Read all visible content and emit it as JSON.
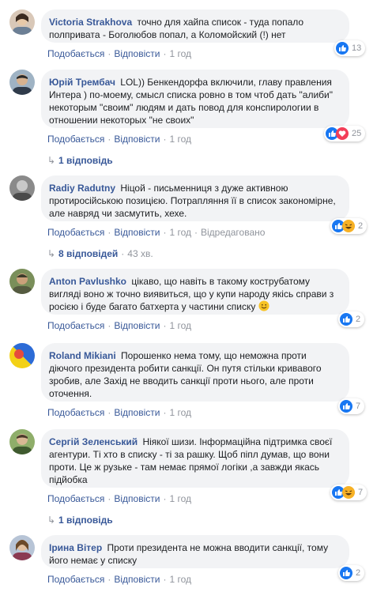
{
  "actions": {
    "like": "Подобається",
    "reply": "Відповісти"
  },
  "colors": {
    "link": "#385898",
    "bubble": "#f2f3f5",
    "like_blue": "#1877f2",
    "love_red": "#f33e58",
    "haha_yellow": "#f7b125"
  },
  "comments": [
    {
      "author": "Victoria Strakhova",
      "text": "точно для хайпа список - туда попало полприватa - Боголюбов попал, а Коломойский (!) нет",
      "time": "1 год",
      "reactions": {
        "icons": [
          "like-icon"
        ],
        "count": "13"
      }
    },
    {
      "author": "Юрій Трембач",
      "text": "LOL)) Бенкендорфа включили, главу правления Интера ) по-моему, смысл списка ровно в том чтоб дать \"алиби\" некоторым \"своим\" людям и дать повод для конспирологии в отношении некоторых \"не своих\"",
      "time": "1 год",
      "reactions": {
        "icons": [
          "like-icon",
          "love-icon"
        ],
        "count": "25"
      },
      "replies": "1 відповідь"
    },
    {
      "author": "Radiy Radutny",
      "text": "Ніцой - письменниця з дуже активною протиросійською позицією. Потрапляння її в список закономірне, але навряд чи засмутить, хехе.",
      "time": "1 год",
      "edited": "Відредаговано",
      "reactions": {
        "icons": [
          "like-icon",
          "haha-icon"
        ],
        "count": "2"
      },
      "replies": "8 відповідей",
      "replies_time": "43 хв."
    },
    {
      "author": "Anton Pavlushko",
      "text": "цікаво, що навіть в такому кострубатому вигляді воно ж точно виявиться, що у купи народу якісь справи з росією і буде багато батхерта у частини списку",
      "time": "1 год",
      "reactions": {
        "icons": [
          "like-icon"
        ],
        "count": "2"
      }
    },
    {
      "author": "Roland Mikiani",
      "text": "Порошенко нема тому, що неможна проти діючого президента робити санкції. Он путя стільки кривавого зробив, але Захід не вводить санкції проти нього, але проти оточення.",
      "time": "1 год",
      "reactions": {
        "icons": [
          "like-icon"
        ],
        "count": "7"
      }
    },
    {
      "author": "Сергій Зеленський",
      "text": "Ніякої шизи. Інформаційна підтримка своєї агентури. Ті хто в списку - ті за рашку. Щоб піпл думав, що вони проти. Це ж рузьке - там немає прямої логіки ,а завжди якась підйобка",
      "time": "1 год",
      "reactions": {
        "icons": [
          "like-icon",
          "haha-icon"
        ],
        "count": "7"
      },
      "replies": "1 відповідь"
    },
    {
      "author": "Ірина Вітер",
      "text": "Проти президента не можна вводити санкції, тому його немає у списку",
      "time": "1 год",
      "reactions": {
        "icons": [
          "like-icon"
        ],
        "count": "2"
      }
    }
  ]
}
